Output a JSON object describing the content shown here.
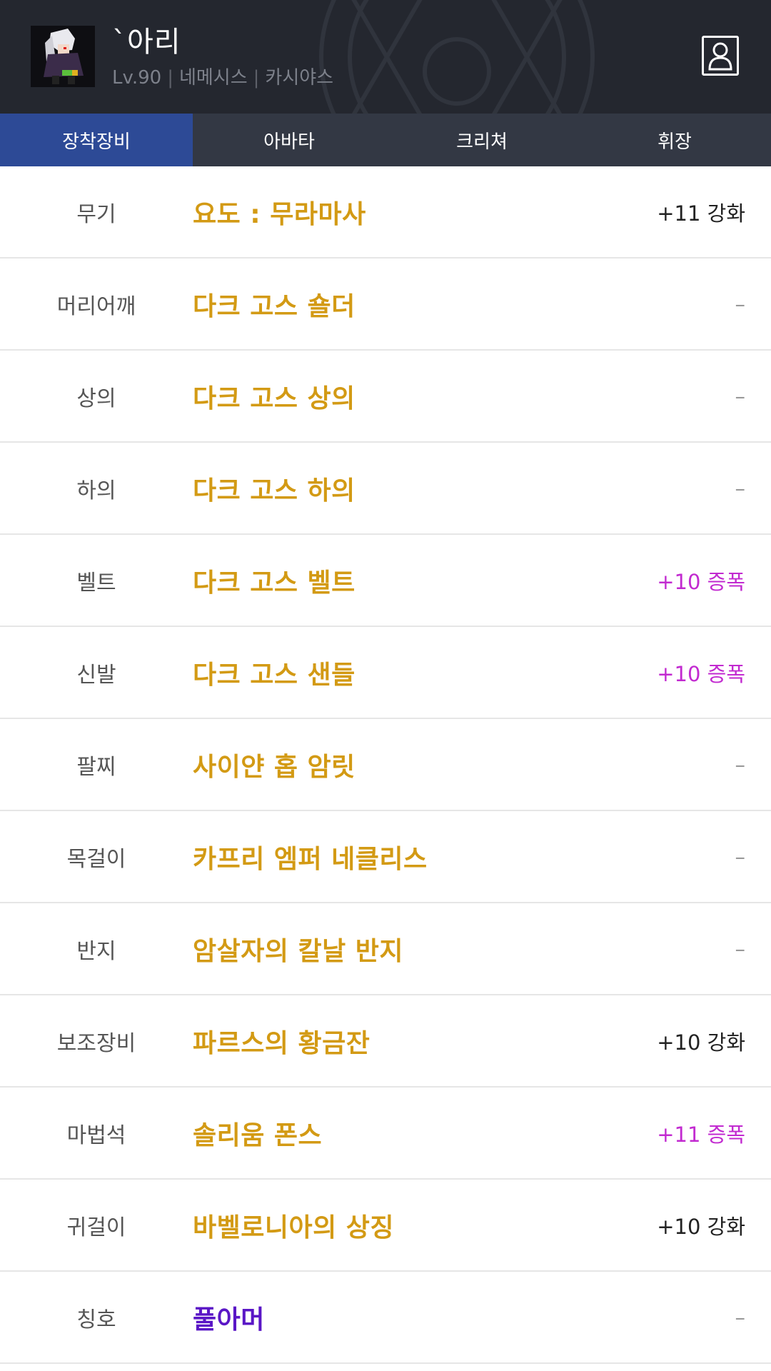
{
  "character": {
    "name": "`아리",
    "level": "Lv.90",
    "job": "네메시스",
    "server": "카시야스",
    "separator": "|"
  },
  "icons": {
    "avatar": "character-portrait",
    "profile": "person-icon"
  },
  "colors": {
    "header_bg": "#24272f",
    "tab_bar_bg": "#333844",
    "tab_active_bg": "#2d4a96",
    "epic_item": "#d39a14",
    "title_item": "#5a16c6",
    "amplify": "#c22ad0"
  },
  "tabs": [
    {
      "label": "장착장비",
      "active": true
    },
    {
      "label": "아바타",
      "active": false
    },
    {
      "label": "크리쳐",
      "active": false
    },
    {
      "label": "휘장",
      "active": false
    }
  ],
  "equipment": [
    {
      "slot": "무기",
      "item": "요도 : 무라마사",
      "upgrade": "+11 강화"
    },
    {
      "slot": "머리어깨",
      "item": "다크 고스 숄더",
      "upgrade": "–"
    },
    {
      "slot": "상의",
      "item": "다크 고스 상의",
      "upgrade": "–"
    },
    {
      "slot": "하의",
      "item": "다크 고스 하의",
      "upgrade": "–"
    },
    {
      "slot": "벨트",
      "item": "다크 고스 벨트",
      "upgrade": "+10 증폭"
    },
    {
      "slot": "신발",
      "item": "다크 고스 샌들",
      "upgrade": "+10 증폭"
    },
    {
      "slot": "팔찌",
      "item": "사이얀 홉 암릿",
      "upgrade": "–"
    },
    {
      "slot": "목걸이",
      "item": "카프리 엠퍼 네클리스",
      "upgrade": "–"
    },
    {
      "slot": "반지",
      "item": "암살자의 칼날 반지",
      "upgrade": "–"
    },
    {
      "slot": "보조장비",
      "item": "파르스의 황금잔",
      "upgrade": "+10 강화"
    },
    {
      "slot": "마법석",
      "item": "솔리움 폰스",
      "upgrade": "+11 증폭"
    },
    {
      "slot": "귀걸이",
      "item": "바벨로니아의 상징",
      "upgrade": "+10 강화"
    },
    {
      "slot": "칭호",
      "item": "풀아머",
      "upgrade": "–"
    }
  ]
}
